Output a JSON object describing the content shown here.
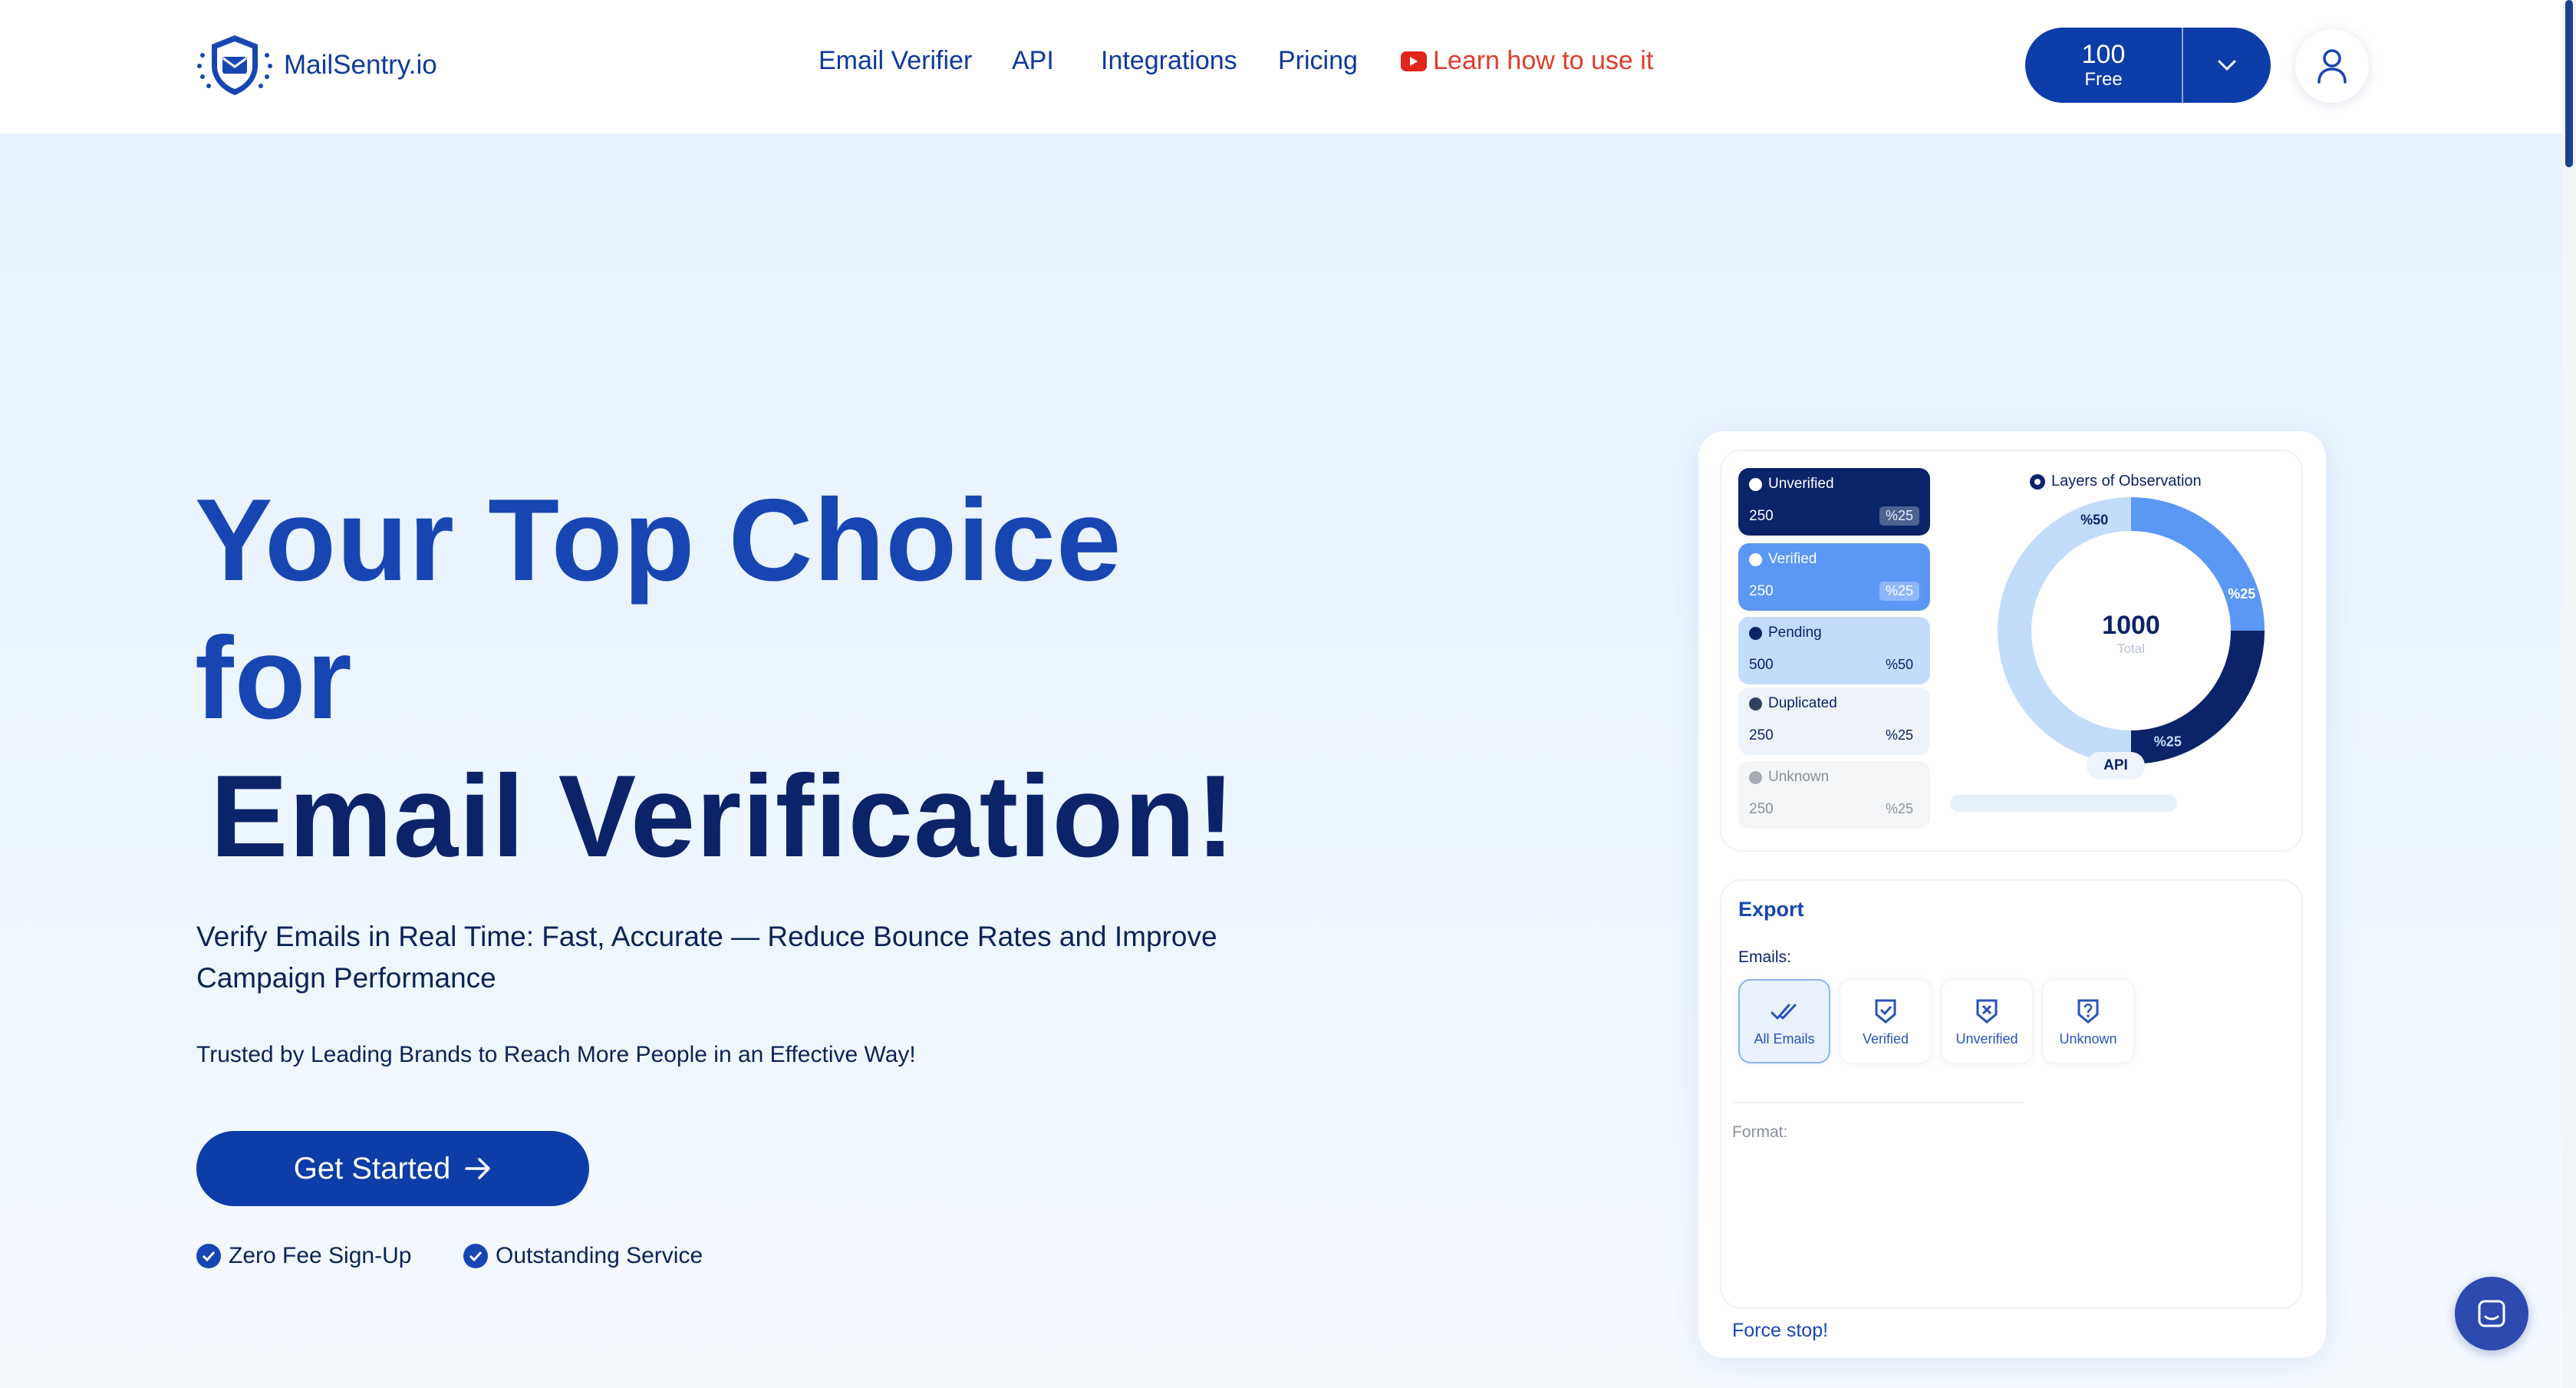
{
  "header": {
    "brand": "MailSentry.io",
    "nav": [
      {
        "label": "Email Verifier"
      },
      {
        "label": "API"
      },
      {
        "label": "Integrations"
      },
      {
        "label": "Pricing"
      }
    ],
    "tutorial_link": "Learn how to use it",
    "credits": {
      "count": "100",
      "label": "Free"
    }
  },
  "hero": {
    "headline_line1": "Your Top Choice",
    "headline_line2": "for",
    "headline_line3": "Email Verification!",
    "subheading": "Verify Emails in Real Time: Fast, Accurate — Reduce Bounce Rates and Improve Campaign Performance",
    "trusted": "Trusted by Leading Brands to Reach More People in an Effective Way!",
    "cta_label": "Get Started",
    "features": [
      "Zero Fee Sign-Up",
      "Outstanding Service"
    ]
  },
  "mockup": {
    "stats": [
      {
        "name": "Unverified",
        "count": "250",
        "percent": "%25"
      },
      {
        "name": "Verified",
        "count": "250",
        "percent": "%25"
      },
      {
        "name": "Pending",
        "count": "500",
        "percent": "%50"
      },
      {
        "name": "Duplicated",
        "count": "250",
        "percent": "%25"
      },
      {
        "name": "Unknown",
        "count": "250",
        "percent": "%25"
      }
    ],
    "observation_title": "Layers of Observation",
    "donut": {
      "total": "1000",
      "total_label": "Total",
      "segments": [
        {
          "label": "%25",
          "value": 25,
          "color": "#5b97f5"
        },
        {
          "label": "%25",
          "value": 25,
          "color": "#0b2368"
        },
        {
          "label": "%50",
          "value": 50,
          "color": "#c3dcfb"
        }
      ]
    },
    "api_badge": "API",
    "export": {
      "title": "Export",
      "emails_label": "Emails:",
      "filters": [
        "All Emails",
        "Verified",
        "Unverified",
        "Unknown"
      ],
      "format_label": "Format:"
    },
    "force_stop": "Force stop!"
  },
  "colors": {
    "brand": "#0d3da8",
    "headline_primary": "#1746b3",
    "headline_dark": "#0b2368",
    "youtube_red": "#e0251b",
    "hero_background": "#e6f2fd"
  }
}
